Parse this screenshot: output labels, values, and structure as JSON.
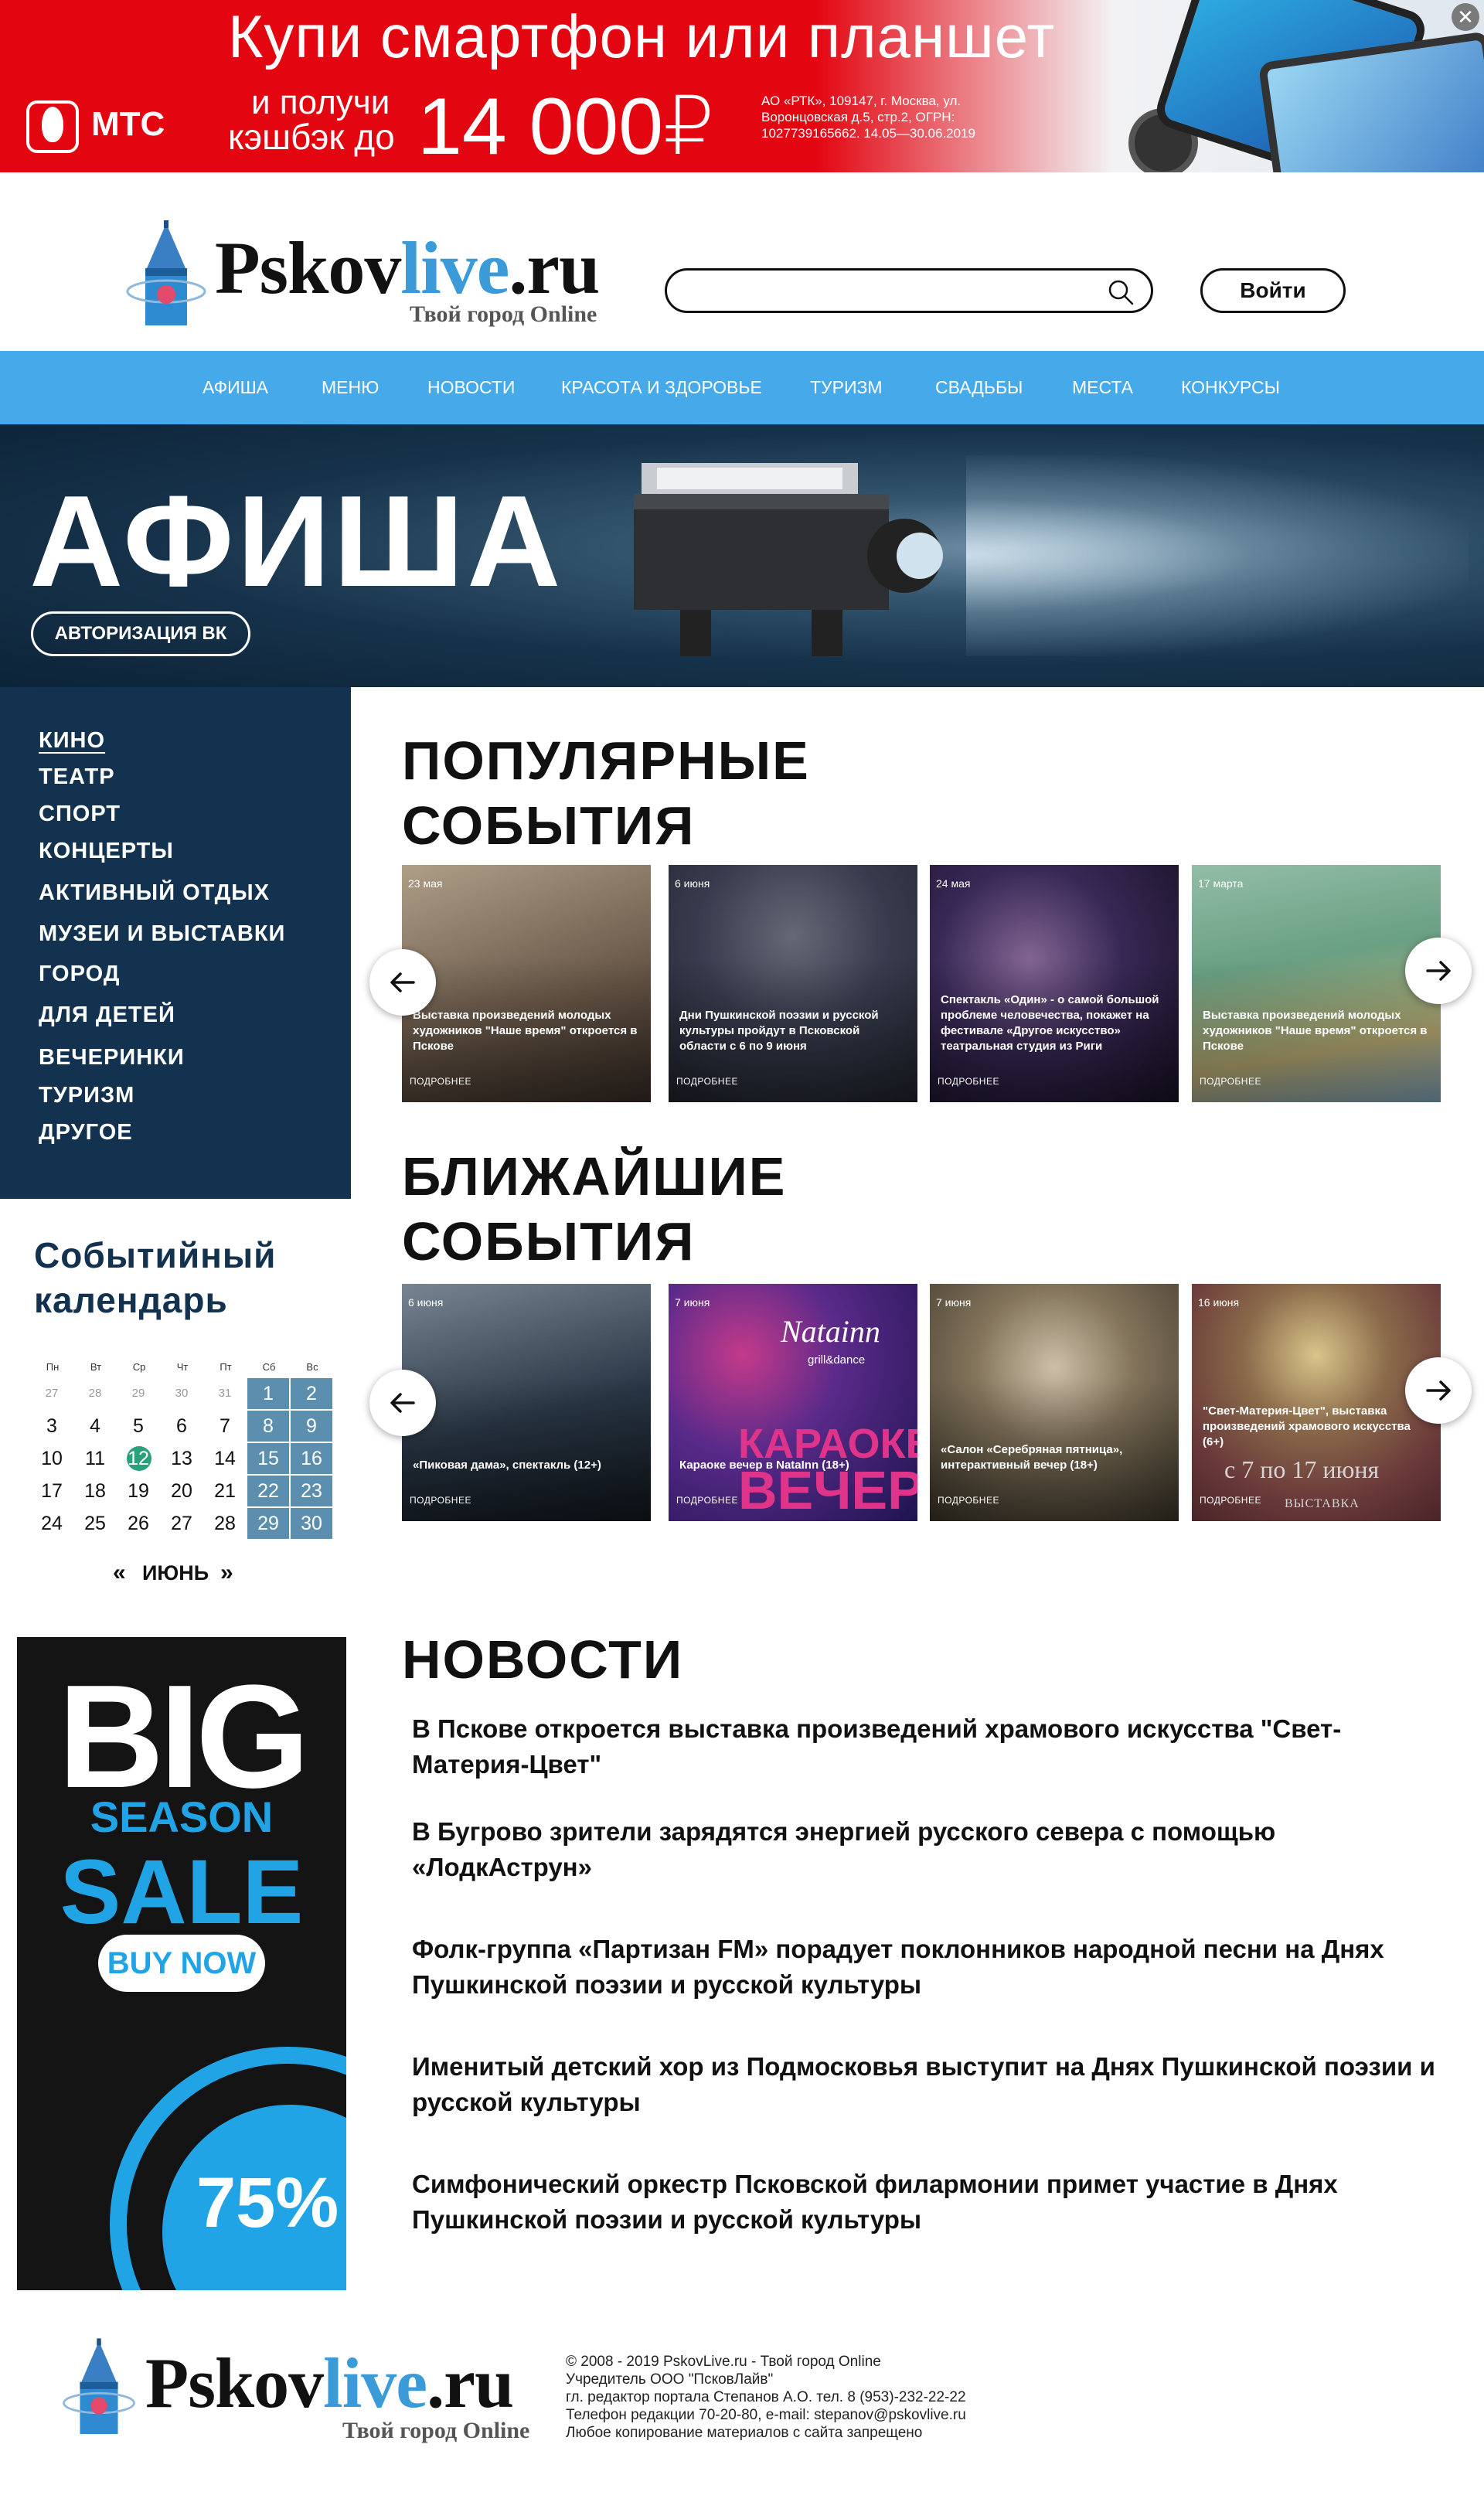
{
  "ad_top": {
    "brand": "МТС",
    "headline": "Купи смартфон или планшет",
    "sub_line1": "и получи",
    "sub_line2": "кэшбэк до",
    "amount": "14 000₽",
    "legal": "АО «РТК», 109147, г. Москва, ул. Воронцовская д.5, стр.2, ОГРН: 1027739165662. 14.05—30.06.2019",
    "close_label": "✕"
  },
  "header": {
    "logo_main": "Pskov",
    "logo_accent": "live",
    "logo_tld": ".ru",
    "slogan": "Твой город Online",
    "search_placeholder": "",
    "login_label": "Войти"
  },
  "nav": {
    "items": [
      "АФИША",
      "МЕНЮ",
      "НОВОСТИ",
      "КРАСОТА И ЗДОРОВЬЕ",
      "ТУРИЗМ",
      "СВАДЬБЫ",
      "МЕСТА",
      "КОНКУРСЫ"
    ]
  },
  "hero": {
    "title": "АФИША",
    "vk_button": "АВТОРИЗАЦИЯ ВК"
  },
  "categories": [
    "КИНО",
    "ТЕАТР",
    "СПОРТ",
    "КОНЦЕРТЫ",
    "АКТИВНЫЙ ОТДЫХ",
    "МУЗЕИ И ВЫСТАВКИ",
    "ГОРОД",
    "ДЛЯ ДЕТЕЙ",
    "ВЕЧЕРИНКИ",
    "ТУРИЗМ",
    "ДРУГОЕ"
  ],
  "popular": {
    "title_line1": "ПОПУЛЯРНЫЕ",
    "title_line2": "СОБЫТИЯ",
    "cards": [
      {
        "date": "23 мая",
        "caption": "Выставка произведений молодых художников \"Наше время\" откроется в Пскове",
        "more": "ПОДРОБНЕЕ",
        "bg": "#8a7a6a"
      },
      {
        "date": "6 июня",
        "caption": "Дни Пушкинской поэзии и русской культуры пройдут в Псковской области с 6 по 9 июня",
        "more": "ПОДРОБНЕЕ",
        "bg": "#3b3f52"
      },
      {
        "date": "24 мая",
        "caption": "Спектакль «Один» - о самой большой проблеме человечества, покажет на фестивале «Другое искусство» театральная студия из Риги",
        "more": "ПОДРОБНЕЕ",
        "bg": "#2a2040"
      },
      {
        "date": "17 марта",
        "caption": "Выставка произведений молодых художников \"Наше время\" откроется в Пскове",
        "more": "ПОДРОБНЕЕ",
        "bg": "#6fa88a"
      }
    ]
  },
  "upcoming": {
    "title_line1": "БЛИЖАЙШИЕ",
    "title_line2": "СОБЫТИЯ",
    "cards": [
      {
        "date": "6 июня",
        "caption": "«Пиковая дама», спектакль (12+)",
        "more": "ПОДРОБНЕЕ",
        "bg": "#2c3a4a"
      },
      {
        "date": "7 июня",
        "caption": "Караоке вечер в NataInn (18+)",
        "more": "ПОДРОБНЕЕ",
        "bg": "#3a2a6a"
      },
      {
        "date": "7 июня",
        "caption": "«Салон «Серебряная пятница», интерактивный вечер (18+)",
        "more": "ПОДРОБНЕЕ",
        "bg": "#5a5040"
      },
      {
        "date": "16 июня",
        "caption": "\"Свет-Материя-Цвет\", выставка произведений храмового искусства (6+)",
        "more": "ПОДРОБНЕЕ",
        "bg": "#7a4a4a"
      }
    ],
    "karaoke_word1": "КАРАОКЕ",
    "karaoke_word2": "ВЕЧЕР",
    "natainn_logo": "Natainn",
    "natainn_sub": "grill&dance",
    "dates_overlay": "с 7 по 17 июня",
    "exhibit_word": "ВЫСТАВКА"
  },
  "calendar": {
    "title_line1": "Событийный",
    "title_line2": "календарь",
    "weekdays": [
      "Пн",
      "Вт",
      "Ср",
      "Чт",
      "Пт",
      "Сб",
      "Вс"
    ],
    "weeks": [
      [
        "27",
        "28",
        "29",
        "30",
        "31",
        "1",
        "2"
      ],
      [
        "3",
        "4",
        "5",
        "6",
        "7",
        "8",
        "9"
      ],
      [
        "10",
        "11",
        "12",
        "13",
        "14",
        "15",
        "16"
      ],
      [
        "17",
        "18",
        "19",
        "20",
        "21",
        "22",
        "23"
      ],
      [
        "24",
        "25",
        "26",
        "27",
        "28",
        "29",
        "30"
      ]
    ],
    "today": "12",
    "month": "ИЮНЬ",
    "prev": "«",
    "next": "»"
  },
  "ad_left": {
    "big": "BIG",
    "season": "SEASON",
    "sale": "SALE",
    "buy": "BUY NOW",
    "percent": "75%"
  },
  "news": {
    "title": "НОВОСТИ",
    "items": [
      "В Пскове откроется выставка произведений храмового искусства \"Свет-Материя-Цвет\"",
      "В Бугрово зрители зарядятся энергией русского севера с помощью «ЛодкАструн»",
      "Фолк-группа «Партизан FM» порадует поклонников народной песни на Днях Пушкинской поэзии и русской культуры",
      "Именитый детский хор из Подмосковья выступит на Днях Пушкинской поэзии и русской культуры",
      "Симфонический оркестр Псковской филармонии примет участие в Днях Пушкинской поэзии и русской культуры"
    ]
  },
  "footer": {
    "lines": [
      "© 2008 - 2019 PskovLive.ru - Твой город Online",
      "Учредитель ООО \"ПсковЛайв\"",
      "гл. редактор портала Степанов А.О. тел. 8 (953)-232-22-22",
      "Телефон редакции 70-20-80, e-mail: stepanov@pskovlive.ru",
      "Любое копирование материалов с сайта запрещено"
    ]
  },
  "colors": {
    "nav": "#45a9ea",
    "sidebar": "#12324f",
    "accent_ad": "#21a4e6",
    "weekend": "#5c8fae",
    "today": "#2aa17c"
  }
}
